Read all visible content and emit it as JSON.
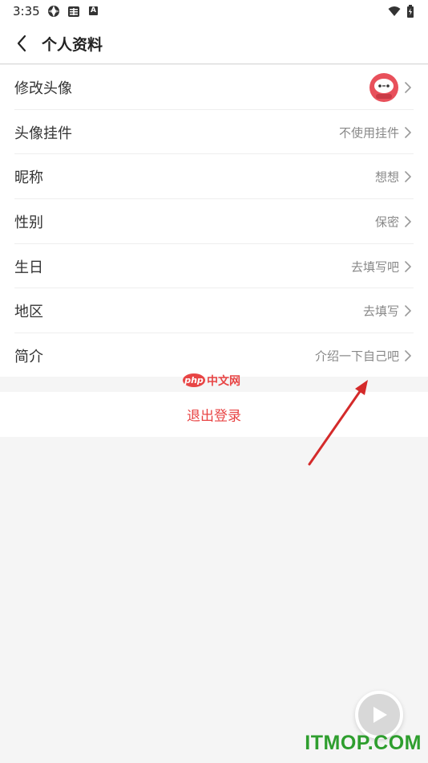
{
  "status_bar": {
    "time": "3:35",
    "icon_badge": "A"
  },
  "header": {
    "title": "个人资料"
  },
  "rows": [
    {
      "label": "修改头像",
      "value": ""
    },
    {
      "label": "头像挂件",
      "value": "不使用挂件"
    },
    {
      "label": "昵称",
      "value": "想想"
    },
    {
      "label": "性别",
      "value": "保密"
    },
    {
      "label": "生日",
      "value": "去填写吧"
    },
    {
      "label": "地区",
      "value": "去填写"
    },
    {
      "label": "简介",
      "value": "介绍一下自己吧"
    }
  ],
  "logout": {
    "label": "退出登录"
  },
  "watermarks": {
    "php_logo": "php",
    "php_text": "中文网",
    "site": "ITMOP.COM"
  },
  "colors": {
    "accent_red": "#e84545",
    "site_green": "#2e9e2e",
    "avatar_red": "#e8505b"
  },
  "icons": {
    "back": "chevron-left-icon",
    "row_arrow": "chevron-right-icon",
    "avatar": "red-mascot-avatar",
    "play": "play-icon"
  }
}
